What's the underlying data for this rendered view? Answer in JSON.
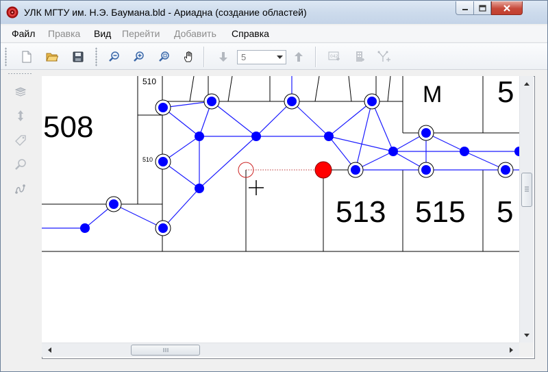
{
  "window": {
    "title": "УЛК МГТУ им. Н.Э. Баумана.bld - Ариадна (создание областей)"
  },
  "menu": {
    "items": [
      {
        "label": "Файл",
        "enabled": true
      },
      {
        "label": "Правка",
        "enabled": false
      },
      {
        "label": "Вид",
        "enabled": true
      },
      {
        "label": "Перейти",
        "enabled": false
      },
      {
        "label": "Добавить",
        "enabled": false
      },
      {
        "label": "Справка",
        "enabled": true
      }
    ]
  },
  "toolbar": {
    "icons": [
      "new-file-icon",
      "open-folder-icon",
      "save-icon",
      "zoom-out-icon",
      "zoom-in-icon",
      "zoom-fit-icon",
      "hand-pan-icon",
      "floor-down-icon",
      "floor-up-icon",
      "number-icon",
      "building-icon",
      "add-node-icon"
    ],
    "floor_value": "5"
  },
  "left_tools": {
    "icons": [
      "layers-icon",
      "vertical-arrows-icon",
      "tag-icon",
      "magnifier-icon",
      "path-icon"
    ]
  },
  "plan": {
    "rooms": [
      {
        "id": "508",
        "label": "508"
      },
      {
        "id": "510-top",
        "label": "510"
      },
      {
        "id": "510-side",
        "label": "510"
      },
      {
        "id": "m",
        "label": "М"
      },
      {
        "id": "5-top",
        "label": "5"
      },
      {
        "id": "513",
        "label": "513"
      },
      {
        "id": "515",
        "label": "515"
      },
      {
        "id": "5-right",
        "label": "5"
      }
    ]
  },
  "colors": {
    "node_fill": "#0000ff",
    "edge": "#1a1aff",
    "selected_node": "#ff0000",
    "pending_node": "#cc2222",
    "wall": "#000000"
  }
}
